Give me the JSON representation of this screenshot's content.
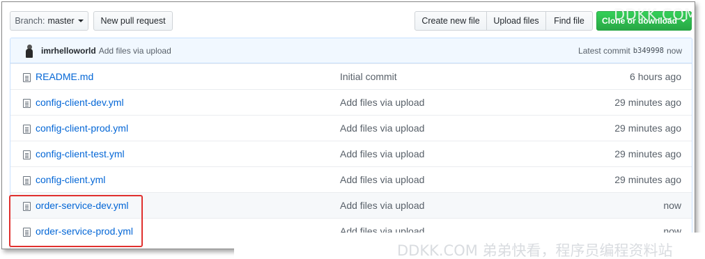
{
  "toolbar": {
    "branch_prefix": "Branch:",
    "branch_name": "master",
    "new_pr": "New pull request",
    "create_file": "Create new file",
    "upload_files": "Upload files",
    "find_file": "Find file",
    "clone": "Clone or download"
  },
  "commit_bar": {
    "author": "imrhelloworld",
    "message": "Add files via upload",
    "latest_label": "Latest commit",
    "sha": "b349998",
    "age": "now"
  },
  "files": [
    {
      "name": "README.md",
      "message": "Initial commit",
      "age": "6 hours ago"
    },
    {
      "name": "config-client-dev.yml",
      "message": "Add files via upload",
      "age": "29 minutes ago"
    },
    {
      "name": "config-client-prod.yml",
      "message": "Add files via upload",
      "age": "29 minutes ago"
    },
    {
      "name": "config-client-test.yml",
      "message": "Add files via upload",
      "age": "29 minutes ago"
    },
    {
      "name": "config-client.yml",
      "message": "Add files via upload",
      "age": "29 minutes ago"
    },
    {
      "name": "order-service-dev.yml",
      "message": "Add files via upload",
      "age": "now"
    },
    {
      "name": "order-service-prod.yml",
      "message": "Add files via upload",
      "age": "now"
    }
  ],
  "watermark": {
    "top": "DDKK.COM",
    "bottom": "DDKK.COM 弟弟快看，程序员编程资料站"
  },
  "colors": {
    "link": "#0366d6",
    "clone_green": "#28a745",
    "commit_bar_bg": "#f1f8ff",
    "highlight_red": "#e0302e"
  }
}
